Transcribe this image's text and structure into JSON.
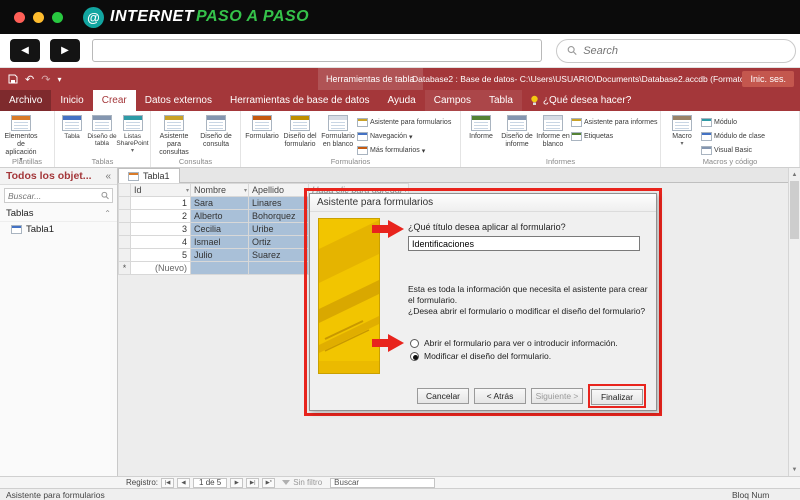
{
  "icons": {
    "back": "◀",
    "forward": "▶",
    "dropdown_caret": "▾",
    "collapse_chevrons": "«",
    "section_chevron": "⌃",
    "undo": "↶",
    "redo": "↷",
    "asterisk": "*",
    "logo_symbol": "@",
    "nav_first": "|◀",
    "nav_prev": "◀",
    "nav_next": "▶",
    "nav_last": "▶|",
    "nav_new": "▶*",
    "scroll_up": "▲",
    "scroll_down": "▼"
  },
  "browser": {
    "brand_first": "INTERNET",
    "brand_second": "PASO A PASO",
    "search_placeholder": "Search"
  },
  "access": {
    "titlebar": {
      "contextual": "Herramientas de tabla",
      "title": "Database2 : Base de datos- C:\\Users\\USUARIO\\Documents\\Database2.accdb (Formato...",
      "signin": "Inic. ses."
    },
    "tabs": [
      "Archivo",
      "Inicio",
      "Crear",
      "Datos externos",
      "Herramientas de base de datos",
      "Ayuda",
      "Campos",
      "Tabla"
    ],
    "tellme": "¿Qué desea hacer?",
    "ribbon": {
      "plantillas": {
        "label": "Plantillas",
        "elementos": "Elementos de aplicación"
      },
      "tablas": {
        "label": "Tablas",
        "tabla": "Tabla",
        "diseno": "Diseño de tabla",
        "listas": "Listas SharePoint"
      },
      "consultas": {
        "label": "Consultas",
        "asistente": "Asistente para consultas",
        "diseno": "Diseño de consulta"
      },
      "formularios": {
        "label": "Formularios",
        "formulario": "Formulario",
        "diseno": "Diseño del formulario",
        "blanco": "Formulario en blanco",
        "asistente": "Asistente para formularios",
        "navegacion": "Navegación",
        "mas": "Más formularios"
      },
      "informes": {
        "label": "Informes",
        "informe": "Informe",
        "diseno": "Diseño de informe",
        "blanco": "Informe en blanco",
        "asistente": "Asistente para informes",
        "etiquetas": "Etiquetas"
      },
      "macros": {
        "label": "Macros y código",
        "macro": "Macro",
        "modulo": "Módulo",
        "modulo_clase": "Módulo de clase",
        "vb": "Visual Basic"
      }
    },
    "nav_pane": {
      "title": "Todos los objet...",
      "search_placeholder": "Buscar...",
      "section": "Tablas",
      "item": "Tabla1"
    },
    "datasheet": {
      "tab": "Tabla1",
      "columns": [
        "Id",
        "Nombre",
        "Apellido",
        "Haga clic para agregar"
      ],
      "rows": [
        [
          "1",
          "Sara",
          "Linares"
        ],
        [
          "2",
          "Alberto",
          "Bohorquez"
        ],
        [
          "3",
          "Cecilia",
          "Uribe"
        ],
        [
          "4",
          "Ismael",
          "Ortiz"
        ],
        [
          "5",
          "Julio",
          "Suarez"
        ]
      ],
      "new_row_label": "(Nuevo)"
    },
    "dialog": {
      "title": "Asistente para formularios",
      "question_title": "¿Qué título desea aplicar al formulario?",
      "title_value": "Identificaciones",
      "info": "Esta es toda la información que necesita el asistente para crear el formulario.",
      "question_open": "¿Desea abrir el formulario o modificar el diseño del formulario?",
      "radio_open": "Abrir el formulario para ver o introducir información.",
      "radio_modify": "Modificar el diseño del formulario.",
      "btn_cancel": "Cancelar",
      "btn_back": "< Atrás",
      "btn_next": "Siguiente >",
      "btn_finish": "Finalizar"
    },
    "recordbar": {
      "label": "Registro:",
      "position": "1 de 5",
      "filter": "Sin filtro",
      "search_placeholder": "Buscar"
    },
    "statusbar": {
      "left": "Asistente para formularios",
      "right": "Bloq Num"
    }
  },
  "colors": {
    "access_red": "#A4373A",
    "annotation_red": "#E8241D",
    "selection_blue": "#A9C0D8",
    "wizard_gold": "#F2C500",
    "logo_green": "#35C24A",
    "logo_teal": "#12A5A0"
  }
}
